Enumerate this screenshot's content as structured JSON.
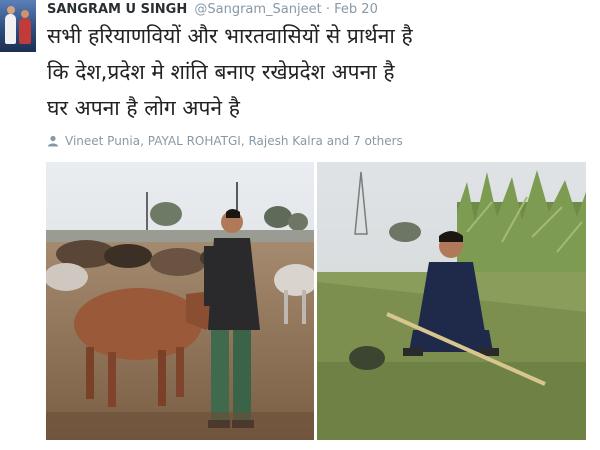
{
  "tweet": {
    "author_name": "SANGRAM U SINGH",
    "author_handle": "@Sangram_Sanjeet",
    "separator": "·",
    "date": "Feb 20",
    "text_lines": [
      "सभी हरियाणवियों और भारतवासियों से प्रार्थना है",
      "कि देश,प्रदेश मे शांति बनाए रखेप्रदेश अपना है",
      "घर अपना है लोग अपने है"
    ],
    "mentions": "Vineet Punia, PAYAL ROHATGI, Rajesh Kalra and 7 others",
    "icons": {
      "mentions": "person-icon"
    }
  }
}
